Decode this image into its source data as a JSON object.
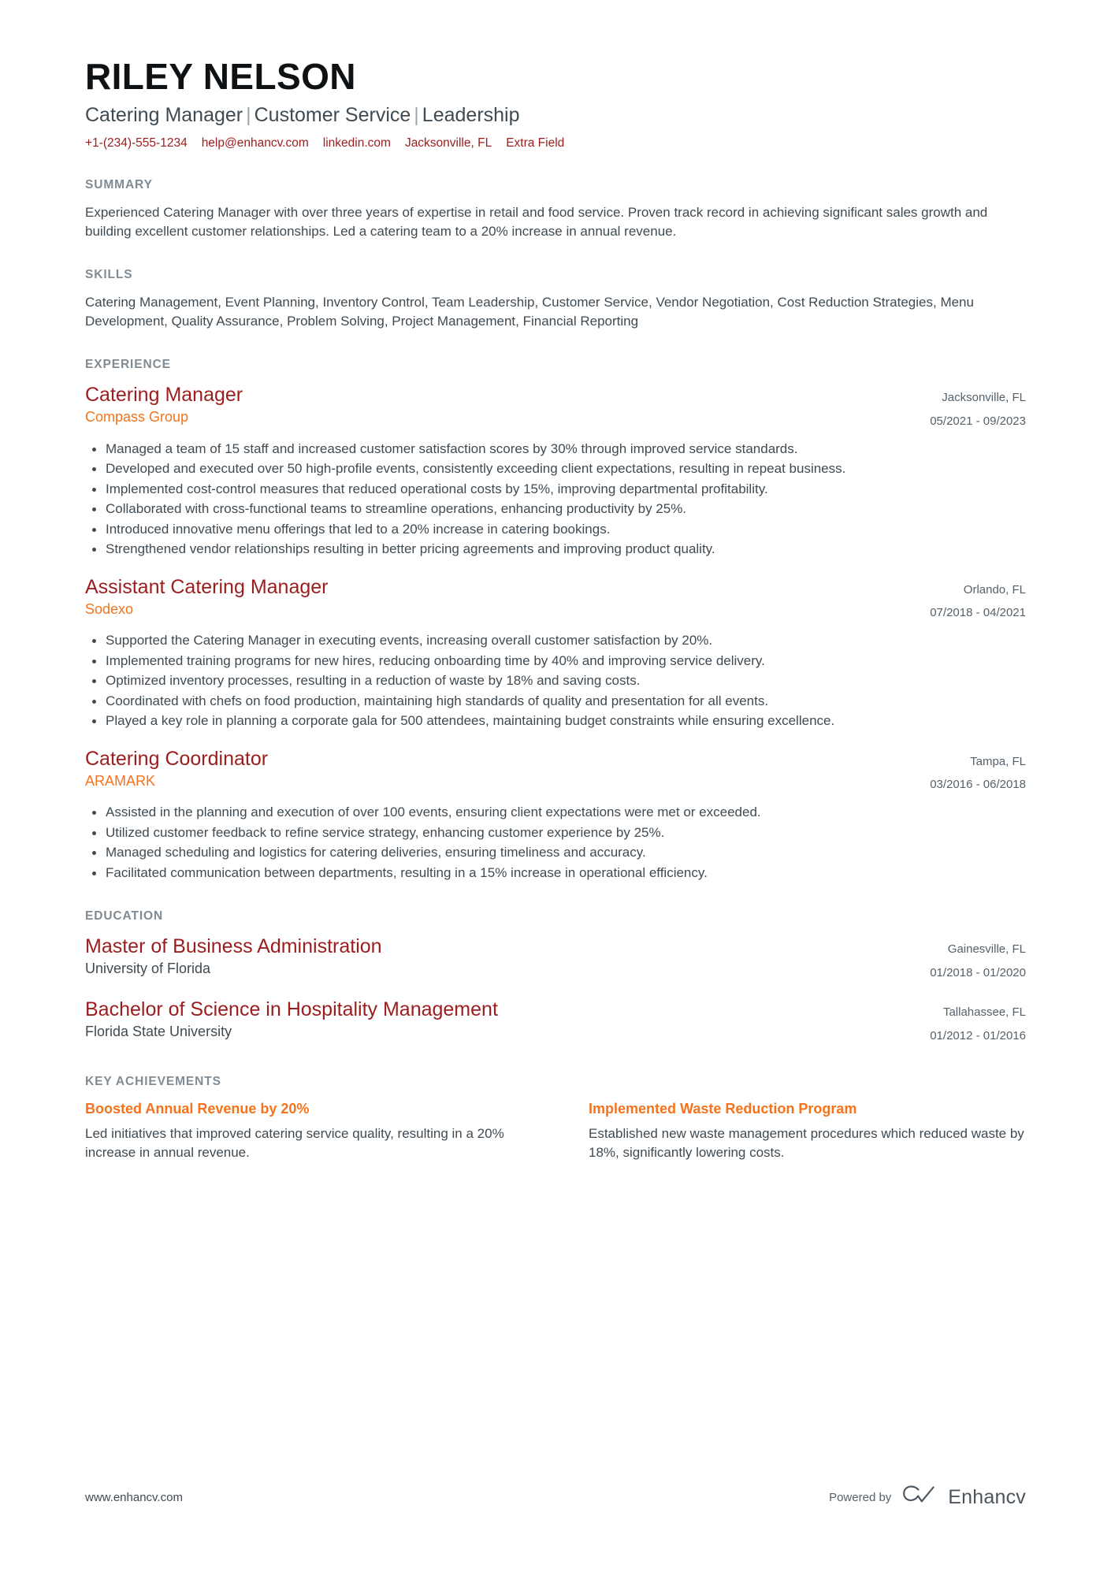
{
  "header": {
    "name": "RILEY NELSON",
    "headline_parts": [
      "Catering Manager",
      "Customer Service",
      "Leadership"
    ],
    "contact": [
      {
        "name": "phone",
        "value": "+1-(234)-555-1234"
      },
      {
        "name": "email",
        "value": "help@enhancv.com"
      },
      {
        "name": "linkedin",
        "value": "linkedin.com"
      },
      {
        "name": "location",
        "value": "Jacksonville, FL"
      },
      {
        "name": "extra",
        "value": "Extra Field"
      }
    ],
    "accent_red": "#9c1d1d",
    "accent_orange": "#f4731c",
    "heading_gray": "#808b93"
  },
  "summary": {
    "title": "SUMMARY",
    "text": "Experienced Catering Manager with over three years of expertise in retail and food service. Proven track record in achieving significant sales growth and building excellent customer relationships. Led a catering team to a 20% increase in annual revenue."
  },
  "skills": {
    "title": "SKILLS",
    "text": "Catering Management, Event Planning, Inventory Control, Team Leadership, Customer Service, Vendor Negotiation, Cost Reduction Strategies, Menu Development, Quality Assurance, Problem Solving, Project Management, Financial Reporting"
  },
  "experience": {
    "title": "EXPERIENCE",
    "entries": [
      {
        "role": "Catering Manager",
        "company": "Compass Group",
        "location": "Jacksonville, FL",
        "dates": "05/2021 - 09/2023",
        "bullets": [
          "Managed a team of 15 staff and increased customer satisfaction scores by 30% through improved service standards.",
          "Developed and executed over 50 high-profile events, consistently exceeding client expectations, resulting in repeat business.",
          "Implemented cost-control measures that reduced operational costs by 15%, improving departmental profitability.",
          "Collaborated with cross-functional teams to streamline operations, enhancing productivity by 25%.",
          "Introduced innovative menu offerings that led to a 20% increase in catering bookings.",
          "Strengthened vendor relationships resulting in better pricing agreements and improving product quality."
        ]
      },
      {
        "role": "Assistant Catering Manager",
        "company": "Sodexo",
        "location": "Orlando, FL",
        "dates": "07/2018 - 04/2021",
        "bullets": [
          "Supported the Catering Manager in executing events, increasing overall customer satisfaction by 20%.",
          "Implemented training programs for new hires, reducing onboarding time by 40% and improving service delivery.",
          "Optimized inventory processes, resulting in a reduction of waste by 18% and saving costs.",
          "Coordinated with chefs on food production, maintaining high standards of quality and presentation for all events.",
          "Played a key role in planning a corporate gala for 500 attendees, maintaining budget constraints while ensuring excellence."
        ]
      },
      {
        "role": "Catering Coordinator",
        "company": "ARAMARK",
        "location": "Tampa, FL",
        "dates": "03/2016 - 06/2018",
        "bullets": [
          "Assisted in the planning and execution of over 100 events, ensuring client expectations were met or exceeded.",
          "Utilized customer feedback to refine service strategy, enhancing customer experience by 25%.",
          "Managed scheduling and logistics for catering deliveries, ensuring timeliness and accuracy.",
          "Facilitated communication between departments, resulting in a 15% increase in operational efficiency."
        ]
      }
    ]
  },
  "education": {
    "title": "EDUCATION",
    "entries": [
      {
        "degree": "Master of Business Administration",
        "school": "University of Florida",
        "location": "Gainesville, FL",
        "dates": "01/2018 - 01/2020"
      },
      {
        "degree": "Bachelor of Science in Hospitality Management",
        "school": "Florida State University",
        "location": "Tallahassee, FL",
        "dates": "01/2012 - 01/2016"
      }
    ]
  },
  "achievements": {
    "title": "KEY ACHIEVEMENTS",
    "items": [
      {
        "title": "Boosted Annual Revenue by 20%",
        "description": "Led initiatives that improved catering service quality, resulting in a 20% increase in annual revenue."
      },
      {
        "title": "Implemented Waste Reduction Program",
        "description": "Established new waste management procedures which reduced waste by 18%, significantly lowering costs."
      }
    ]
  },
  "footer": {
    "url": "www.enhancv.com",
    "powered_by": "Powered by",
    "brand": "Enhancv"
  }
}
